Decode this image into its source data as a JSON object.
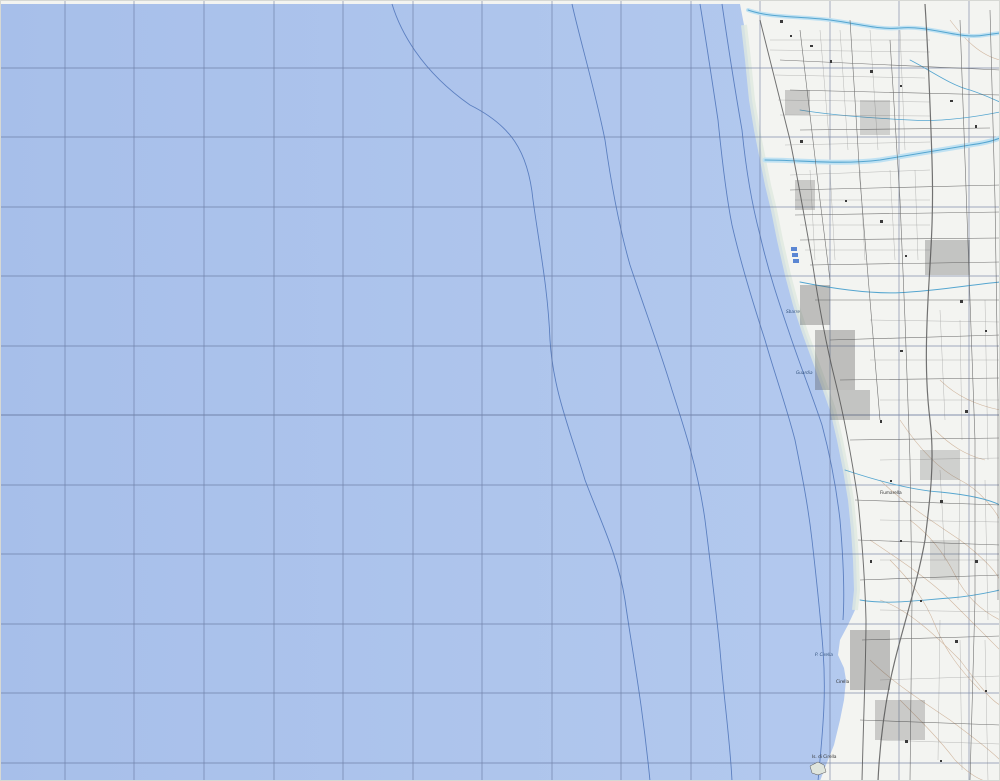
{
  "map": {
    "colors": {
      "sea": "#a9c1eb",
      "sea_deep": "#a2bbe8",
      "grid": "#5d6d94",
      "bathymetry": "#4d73b8",
      "land": "#f3f4f1",
      "roads": "#5b5b5b",
      "built": "#4a4a4a",
      "rivers": "#55a6d0",
      "river_fill": "#bfe1f2",
      "contours": "#c9a98d",
      "beach": "#eef2ea"
    },
    "place_labels": [
      {
        "text": "Sbarre",
        "style": "ital"
      },
      {
        "text": "Guardia",
        "style": "ital"
      },
      {
        "text": "Fiumarella",
        "style": "plain"
      },
      {
        "text": "P. Cirella",
        "style": "ital"
      },
      {
        "text": "Cirella",
        "style": "plain"
      },
      {
        "text": "Is. di Cirella",
        "style": "plain"
      }
    ]
  }
}
